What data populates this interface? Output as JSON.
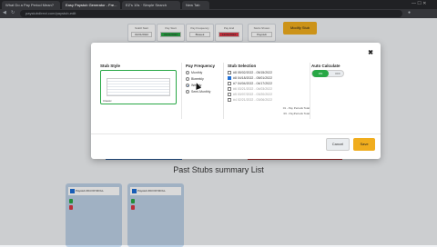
{
  "browser": {
    "tabs": [
      {
        "label": "What Do a Pay Period Mean?"
      },
      {
        "label": "Easy Paystub Generator - Fre..."
      },
      {
        "label": "EZ's 10s · Simple Search"
      },
      {
        "label": "New Tab"
      }
    ],
    "url": "paystubdirect.com/paystub-edit",
    "window_controls": "— ☐ ✕"
  },
  "toolbar": {
    "boxes": [
      {
        "label": "Stub# Start",
        "value": "01/01/2022"
      },
      {
        "label": "Pay Start",
        "value": "01/01/2022"
      },
      {
        "label": "Pay Frequency",
        "value": "Biweek"
      },
      {
        "label": "Pay End",
        "value": "12/31/2022"
      },
      {
        "label": "Stubs Shown",
        "value": "Paystub"
      }
    ],
    "modify_label": "Modify Stub"
  },
  "modal": {
    "close": "✖",
    "stub_style_title": "Stub Style",
    "stub_style_label": "Classic",
    "pay_frequency_title": "Pay Frequency",
    "frequencies": [
      {
        "label": "Monthly",
        "selected": false
      },
      {
        "label": "Biweekly",
        "selected": false
      },
      {
        "label": "Weekly",
        "selected": true
      },
      {
        "label": "Semi-Monthly",
        "selected": false
      }
    ],
    "stub_selection_title": "Stub Selection",
    "stubs": [
      {
        "label": "#8 05/02/2022 - 05/15/2022",
        "checked": false,
        "muted": false
      },
      {
        "label": "#8 04/18/2022 - 05/01/2022",
        "checked": true,
        "muted": false
      },
      {
        "label": "#7 04/04/2022 - 04/17/2022",
        "checked": false,
        "muted": false
      },
      {
        "label": "#6 03/21/2022 - 04/03/2022",
        "checked": false,
        "muted": true
      },
      {
        "label": "#5 03/07/2022 - 03/20/2022",
        "checked": false,
        "muted": true
      },
      {
        "label": "#4 02/21/2022 - 03/06/2022",
        "checked": false,
        "muted": true
      }
    ],
    "stub_meta_1": "01 - Pay Periods Total",
    "stub_meta_2": "06 - PayPeriods Total",
    "auto_calc_title": "Auto Calculate",
    "toggle_on": "ON",
    "toggle_off": "OFF",
    "cancel_label": "Cancel",
    "save_label": "Save"
  },
  "page": {
    "section_title": "Past Stubs summary List",
    "cards": [
      {
        "title": "Paystub #04 PAYROLL"
      },
      {
        "title": "Paystub #03 PAYROLL"
      }
    ]
  }
}
